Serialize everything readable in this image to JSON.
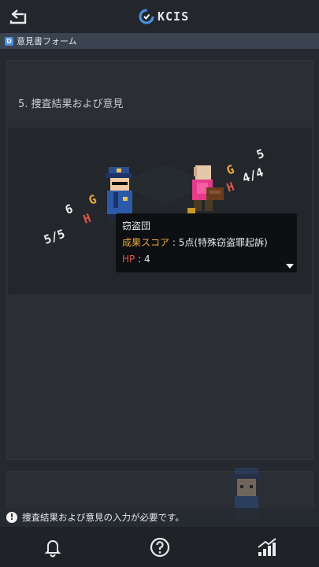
{
  "header": {
    "logo_text": "KCIS",
    "back_icon": "exit-arrow-icon",
    "logo_icon": "kcis-logo-icon"
  },
  "breadcrumb": {
    "badge": "D",
    "label": "意見書フォーム"
  },
  "section": {
    "title": "5. 捜査結果および意見"
  },
  "scene": {
    "police": {
      "g_value": "6",
      "h_value": "5/5",
      "g_label": "G",
      "h_label": "H"
    },
    "thief": {
      "g_value": "5",
      "h_value": "4/4",
      "g_label": "G",
      "h_label": "H"
    }
  },
  "tooltip": {
    "name": "窃盗団",
    "score_label": "成果スコア",
    "score_sep": ":",
    "score_value": "5点(特殊窃盗罪起訴)",
    "hp_label": "HP",
    "hp_sep": ":",
    "hp_value": "4"
  },
  "notice": {
    "icon": "!",
    "text": "捜査結果および意見の入力が必要です。"
  },
  "tabbar": {
    "items": [
      "bell-icon",
      "help-icon",
      "stats-icon"
    ]
  },
  "colors": {
    "background": "#262a30",
    "score_label": "#f0a93a",
    "hp_label": "#e0574a",
    "g_label": "#f0a93a",
    "h_label": "#e0574a"
  }
}
